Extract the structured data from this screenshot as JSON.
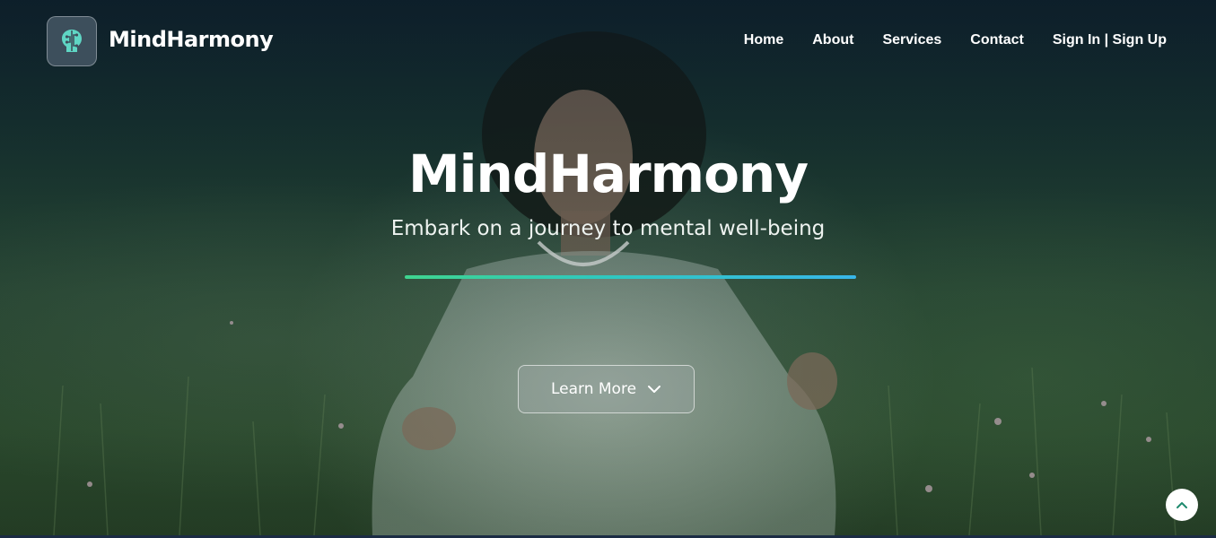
{
  "brand": {
    "name": "MindHarmony",
    "logo_icon": "brain-circuit-icon",
    "accent_color": "#5fd6c4"
  },
  "nav": {
    "items": [
      {
        "label": "Home"
      },
      {
        "label": "About"
      },
      {
        "label": "Services"
      },
      {
        "label": "Contact"
      },
      {
        "label": "Sign In | Sign Up"
      }
    ]
  },
  "hero": {
    "title": "MindHarmony",
    "subtitle": "Embark on a journey to mental well-being",
    "cta_label": "Learn More",
    "cta_icon": "chevron-down-icon",
    "divider_colors": [
      "#3fd48f",
      "#38b6e8"
    ],
    "background_image": "woman-meditating-in-meadow"
  },
  "scroll_top": {
    "icon": "chevron-up-icon"
  }
}
